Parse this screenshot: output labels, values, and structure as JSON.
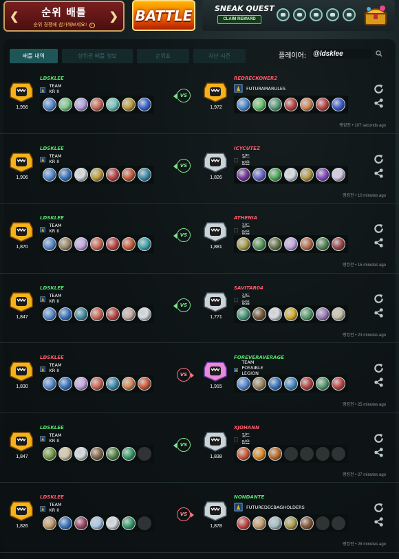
{
  "header": {
    "mode_title": "순위 배틀",
    "mode_subtitle": "순위 경쟁에 참가해보세요!",
    "battle_label": "BATTLE",
    "quest_title": "SNEAK QUEST",
    "claim_label": "CLAIM REWARD"
  },
  "tabs": [
    {
      "label": "배틀 내역",
      "active": true
    },
    {
      "label": "상위권 배틀 정보",
      "active": false
    },
    {
      "label": "순위표",
      "active": false
    },
    {
      "label": "지난 시즌",
      "active": false
    }
  ],
  "search": {
    "label": "플레이어:",
    "value": "@ldsklee"
  },
  "colors": {
    "win": "#4fe46c",
    "lose": "#ff5a6b",
    "accent": "#1e5658"
  },
  "battles": [
    {
      "p1": {
        "name": "LDSKLEE",
        "result": "win",
        "rating": "1,956",
        "badge": "gold",
        "guild": "TEAM KR II",
        "cards": [
          "#5a8fd6",
          "#7ed08a",
          "#b9a3e6",
          "#d26a5a",
          "#6fc9c0",
          "#c2a13f",
          "#3a66d4"
        ]
      },
      "p2": {
        "name": "REDRECKONER2",
        "result": "lose",
        "rating": "1,972",
        "badge": "gold",
        "guild": "FUTURAMARULES",
        "cards": [
          "#4f8fd8",
          "#6cc96e",
          "#5ca07a",
          "#c04848",
          "#d88a5a",
          "#c24a4a",
          "#3f5fd2"
        ]
      },
      "vs_result": "win",
      "vs_label": "VS",
      "time": "랭킹전 • 107 seconds ago"
    },
    {
      "p1": {
        "name": "LDSKLEE",
        "result": "win",
        "rating": "1,906",
        "badge": "gold",
        "guild": "TEAM KR II",
        "cards": [
          "#5a8fd6",
          "#3c78c4",
          "#d8dde4",
          "#c2a13f",
          "#c04848",
          "#d06040",
          "#3f8fb0"
        ]
      },
      "p2": {
        "name": "ICYCUTEZ",
        "result": "lose",
        "rating": "1,826",
        "badge": "silver",
        "guild": "길드 없음",
        "cards": [
          "#7a3aa0",
          "#6a6ad0",
          "#4fae5a",
          "#d8dde4",
          "#b89f4a",
          "#8a4fc8",
          "#d8c8e8"
        ]
      },
      "vs_result": "win",
      "vs_label": "VS",
      "time": "랭킹전 • 10 minutes ago"
    },
    {
      "p1": {
        "name": "LDSKLEE",
        "result": "win",
        "rating": "1,870",
        "badge": "gold",
        "guild": "TEAM KR II",
        "cards": [
          "#5a8fd6",
          "#a08a6a",
          "#c8a8e8",
          "#d26a5a",
          "#c04848",
          "#d06040",
          "#3fa8b0"
        ]
      },
      "p2": {
        "name": "ATHENIA",
        "result": "lose",
        "rating": "1,881",
        "badge": "silver",
        "guild": "길드 없음",
        "cards": [
          "#b0a050",
          "#5a9a5a",
          "#6a7a4a",
          "#c8a8e8",
          "#c07050",
          "#5a8a5a",
          "#a04a4a"
        ]
      },
      "vs_result": "win",
      "vs_label": "VS",
      "time": "랭킹전 • 15 minutes ago"
    },
    {
      "p1": {
        "name": "LDSKLEE",
        "result": "win",
        "rating": "1,847",
        "badge": "gold",
        "guild": "TEAM KR II",
        "cards": [
          "#5a8fd6",
          "#3c78c4",
          "#4a90a8",
          "#d26a5a",
          "#c04848",
          "#c9b0a8",
          "#d8dde4"
        ]
      },
      "p2": {
        "name": "SAVITAR04",
        "result": "lose",
        "rating": "1,771",
        "badge": "silver",
        "guild": "길드 없음",
        "cards": [
          "#4a9a7a",
          "#7a5a3a",
          "#d8dde4",
          "#d8b030",
          "#5aa070",
          "#a080c0",
          "#c8c0a8"
        ]
      },
      "vs_result": "win",
      "vs_label": "VS",
      "time": "랭킹전 • 23 minutes ago"
    },
    {
      "p1": {
        "name": "LDSKLEE",
        "result": "lose",
        "rating": "1,830",
        "badge": "gold",
        "guild": "TEAM KR II",
        "cards": [
          "#5a8fd6",
          "#3c78c4",
          "#c8a8e8",
          "#d26a5a",
          "#3f8fb0",
          "#d88a5a",
          "#d05a3a"
        ]
      },
      "p2": {
        "name": "FOREVERAVERAGE",
        "result": "win",
        "rating": "1,915",
        "badge": "rainbow",
        "guild": "TEAM POSSIBLE LEGION",
        "cards": [
          "#5a8fd6",
          "#a08a6a",
          "#3c78c4",
          "#4a90c8",
          "#c04848",
          "#5aa070",
          "#c84a4a"
        ]
      },
      "vs_result": "lose",
      "vs_label": "VS",
      "time": "랭킹전 • 25 minutes ago"
    },
    {
      "p1": {
        "name": "LDSKLEE",
        "result": "win",
        "rating": "1,847",
        "badge": "gold",
        "guild": "TEAM KR II",
        "cards": [
          "#7aa04a",
          "#d8c8a8",
          "#d8dde4",
          "#8a6a4a",
          "#5a8a4a",
          "#3aa070",
          "empty"
        ]
      },
      "p2": {
        "name": "XJOHANN",
        "result": "lose",
        "rating": "1,838",
        "badge": "silver",
        "guild": "길드 없음",
        "cards": [
          "#d06040",
          "#e0902a",
          "#c07030",
          "empty",
          "empty",
          "empty",
          "empty"
        ]
      },
      "vs_result": "win",
      "vs_label": "VS",
      "time": "랭킹전 • 27 minutes ago"
    },
    {
      "p1": {
        "name": "LDSKLEE",
        "result": "lose",
        "rating": "1,826",
        "badge": "gold",
        "guild": "TEAM KR II",
        "cards": [
          "#c8a070",
          "#3c78c4",
          "#a04a6a",
          "#a8c8e8",
          "#d8dde4",
          "#3aa070",
          "empty"
        ]
      },
      "p2": {
        "name": "NONDANTE",
        "result": "win",
        "rating": "1,878",
        "badge": "silver",
        "guild": "FUTUREDECBAGHOLDERS",
        "cards": [
          "#c84a4a",
          "#c8a070",
          "#a8c0c8",
          "#b0a050",
          "#8a5a3a",
          "empty",
          "empty"
        ]
      },
      "vs_result": "lose",
      "vs_label": "VS",
      "time": "랭킹전 • 28 minutes ago"
    }
  ]
}
